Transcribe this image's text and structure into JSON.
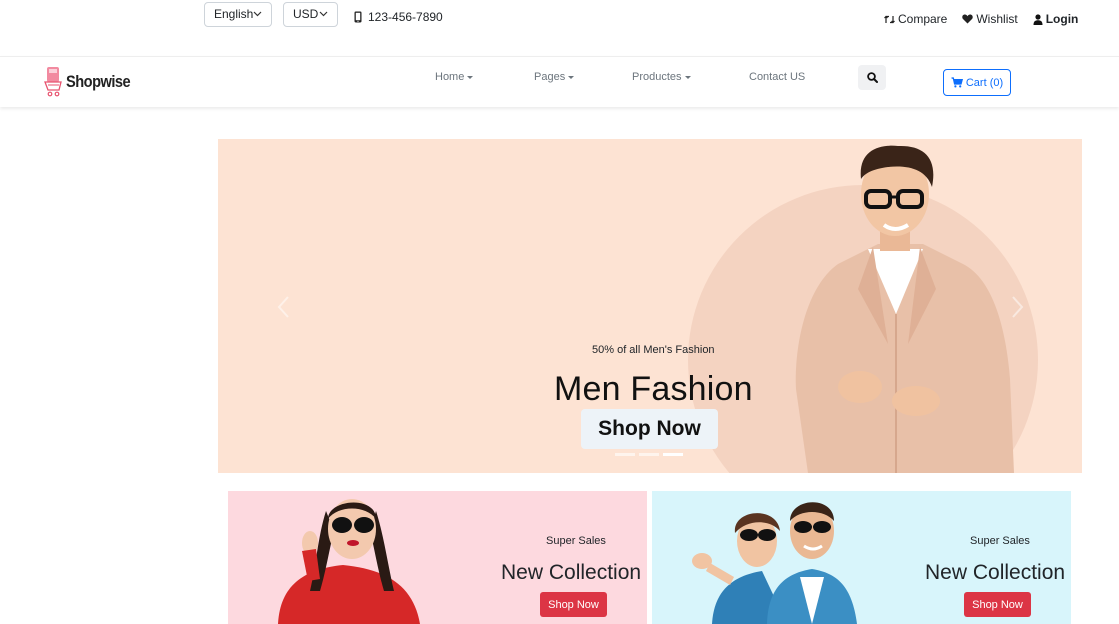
{
  "topbar": {
    "language": "English",
    "currency": "USD",
    "phone": "123-456-7890",
    "compare": "Compare",
    "wishlist": "Wishlist",
    "login": "Login"
  },
  "navbar": {
    "brand": "Shopwise",
    "items": [
      {
        "label": "Home",
        "dropdown": true
      },
      {
        "label": "Pages",
        "dropdown": true
      },
      {
        "label": "Productes",
        "dropdown": true
      },
      {
        "label": "Contact US",
        "dropdown": false
      }
    ],
    "cart": "Cart (0)"
  },
  "hero": {
    "subtitle": "50% of all Men's Fashion",
    "title": "Men Fashion",
    "button": "Shop Now",
    "slides": 3,
    "active_slide": 3
  },
  "banners": [
    {
      "subtitle": "Super Sales",
      "title": "New Collection",
      "button": "Shop Now",
      "image": "woman-red-sweater"
    },
    {
      "subtitle": "Super Sales",
      "title": "New Collection",
      "button": "Shop Now",
      "image": "couple-denim"
    }
  ],
  "colors": {
    "accent_blue": "#0d6efd",
    "danger_red": "#dc3545",
    "hero_bg": "#fde3d3",
    "banner_pink": "#fdd9df",
    "banner_cyan": "#d8f5fb"
  }
}
